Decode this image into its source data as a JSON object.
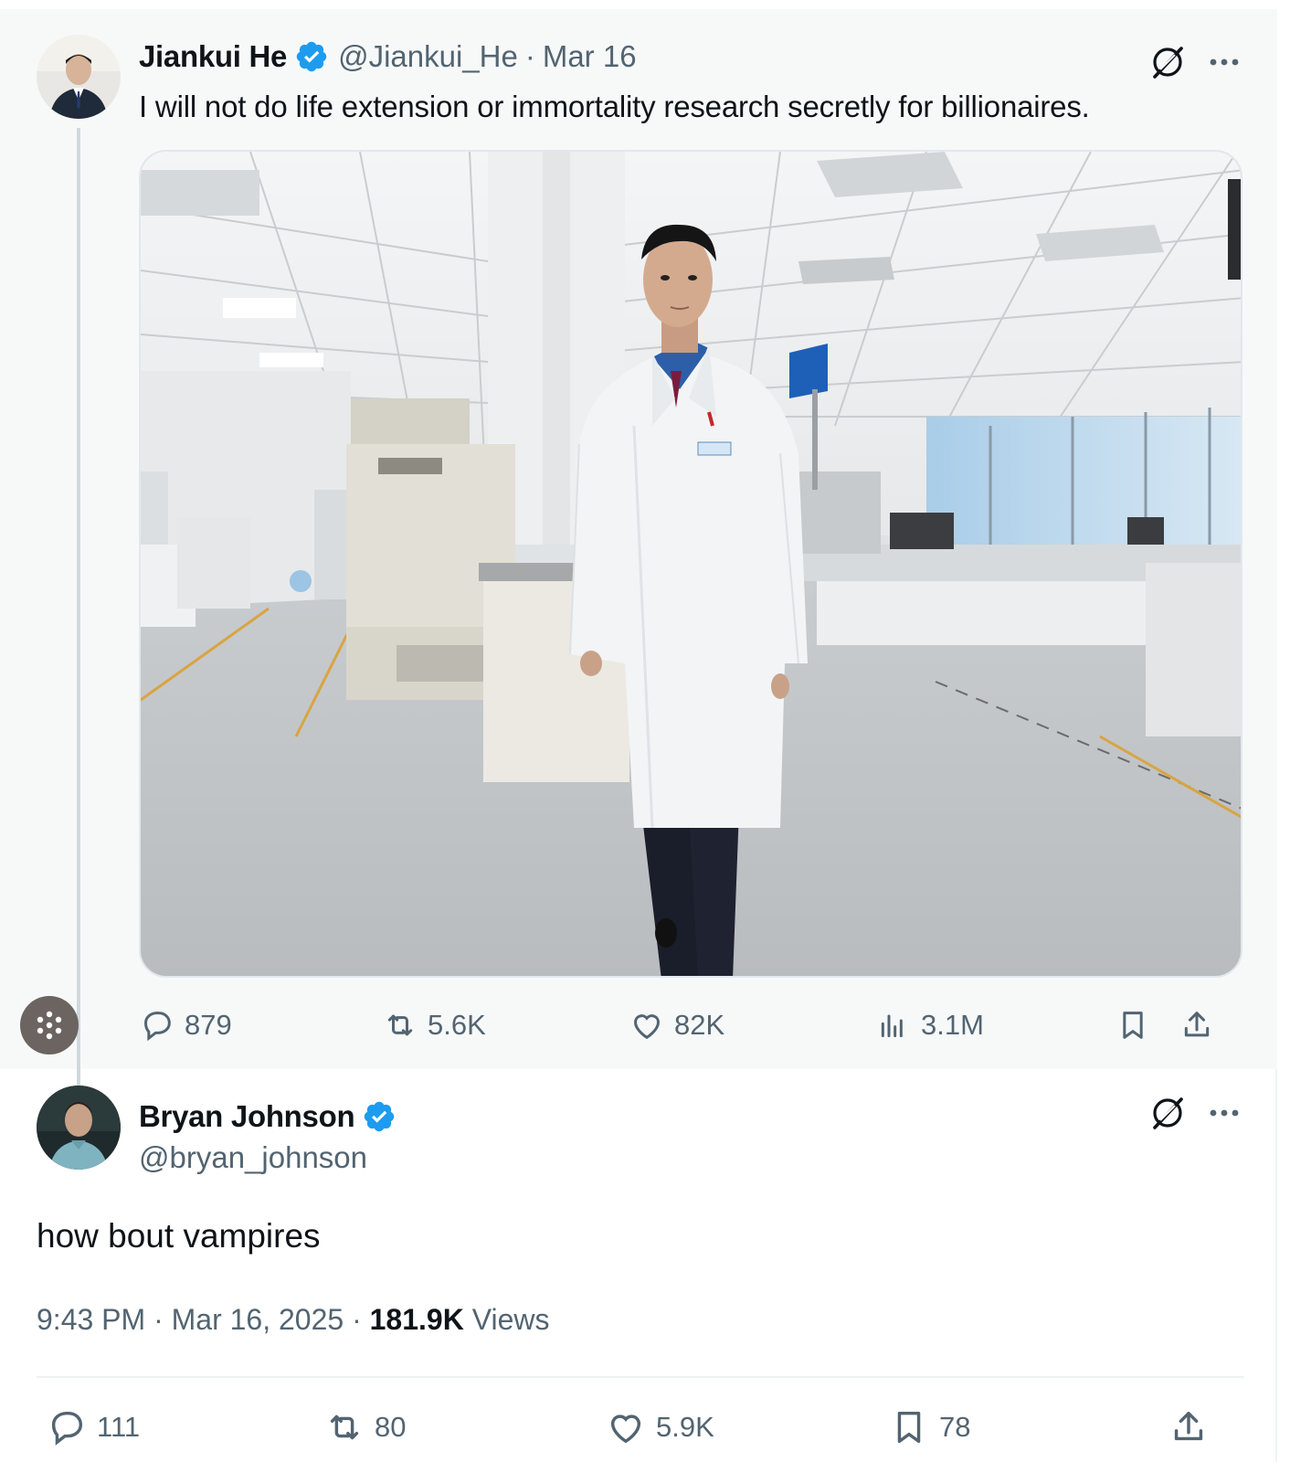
{
  "parent_tweet": {
    "author_name": "Jiankui He",
    "handle": "@Jiankui_He",
    "separator": "·",
    "date": "Mar 16",
    "text": "I will not do life extension or immortality research secretly for billionaires.",
    "media_icon": "photo-lab-coat",
    "stats": {
      "replies": "879",
      "reposts": "5.6K",
      "likes": "82K",
      "views": "3.1M"
    }
  },
  "main_tweet": {
    "author_name": "Bryan Johnson",
    "handle": "@bryan_johnson",
    "text": "how bout vampires",
    "time": "9:43 PM",
    "separator": "·",
    "date": "Mar 16, 2025",
    "views_count": "181.9K",
    "views_label": "Views",
    "stats": {
      "replies": "111",
      "reposts": "80",
      "likes": "5.9K",
      "bookmarks": "78"
    }
  },
  "icons": {
    "verified": "verified-badge-icon",
    "grok": "grok-icon",
    "more": "more-icon"
  },
  "colors": {
    "verified_blue": "#1d9bf0",
    "muted_text": "#536471",
    "primary_text": "#0f1419",
    "parent_bg": "#f7f9f9"
  }
}
